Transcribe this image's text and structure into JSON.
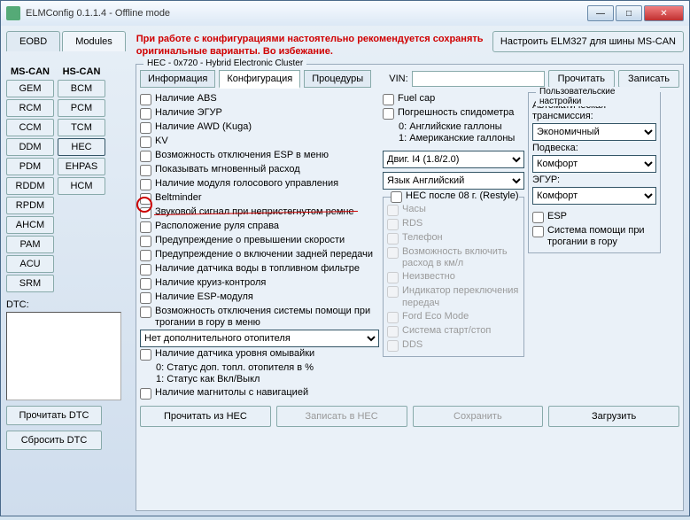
{
  "title": "ELMConfig 0.1.1.4 - Offline mode",
  "tabs": {
    "eobd": "EOBD",
    "modules": "Modules"
  },
  "warning": "При работе с конфигурациями настоятельно рекомендуется сохранять оригинальные варианты. Во избежание.",
  "setup_btn": "Настроить ELM327 для шины MS-CAN",
  "cols": {
    "ms": "MS-CAN",
    "hs": "HS-CAN"
  },
  "ms_mods": [
    "GEM",
    "RCM",
    "CCM",
    "DDM",
    "PDM",
    "RDDM",
    "RPDM",
    "AHCM",
    "PAM",
    "ACU",
    "SRM"
  ],
  "hs_mods": [
    "BCM",
    "PCM",
    "TCM",
    "HEC",
    "EHPAS",
    "HCM"
  ],
  "dtc_label": "DTC:",
  "read_dtc": "Прочитать DTC",
  "reset_dtc": "Сбросить DTC",
  "panel_title": "HEC - 0x720 - Hybrid Electronic Cluster",
  "subtabs": {
    "info": "Информация",
    "config": "Конфигурация",
    "proc": "Процедуры"
  },
  "vin_label": "VIN:",
  "vin_value": "",
  "read_btn": "Прочитать",
  "write_btn": "Записать",
  "checks_left": [
    "Наличие ABS",
    "Наличие ЭГУР",
    "Наличие AWD (Kuga)",
    "KV",
    "Возможность отключения ESP в меню",
    "Показывать мгновенный расход",
    "Наличие модуля голосового управления",
    "Beltminder",
    "Звуковой сигнал при непристегнутом ремне",
    "Расположение руля справа",
    "Предупреждение о превышении скорости",
    "Предупреждение о включении задней передачи",
    "Наличие датчика воды в топливном фильтре",
    "Наличие круиз-контроля",
    "Наличие ESP-модуля",
    "Возможность отключения системы помощи при трогании в гору в меню"
  ],
  "heater_select": "Нет дополнительного отопителя",
  "checks_left2": [
    "Наличие датчика уровня омывайки"
  ],
  "static1": "0: Статус доп. топл. отопителя в %\n1: Статус как Вкл/Выкл",
  "checks_left3": [
    "Наличие магнитолы с навигацией"
  ],
  "checks_mid": [
    "Fuel cap",
    "Погрешность спидометра"
  ],
  "static2": "0: Английские галлоны\n1: Американские галлоны",
  "engine_select": "Двиг. I4 (1.8/2.0)",
  "lang_select": "Язык Английский",
  "restyle_grp": "HEC после 08 г. (Restyle)",
  "restyle_checks": [
    "Часы",
    "RDS",
    "Телефон",
    "Возможность включить расход в км/л",
    "Неизвестно",
    "Индикатор переключения передач",
    "Ford Eco Mode",
    "Система старт/стоп",
    "DDS"
  ],
  "user_grp": "Пользовательские настройки",
  "trans_label": "Автоматическая трансмиссия:",
  "trans_select": "Экономичный",
  "susp_label": "Подвеска:",
  "susp_select": "Комфорт",
  "egur_label": "ЭГУР:",
  "egur_select": "Комфорт",
  "user_checks": [
    "ESP",
    "Система помощи при трогании в гору"
  ],
  "bottom": {
    "read": "Прочитать из HEC",
    "write": "Записать в HEC",
    "save": "Сохранить",
    "load": "Загрузить"
  }
}
